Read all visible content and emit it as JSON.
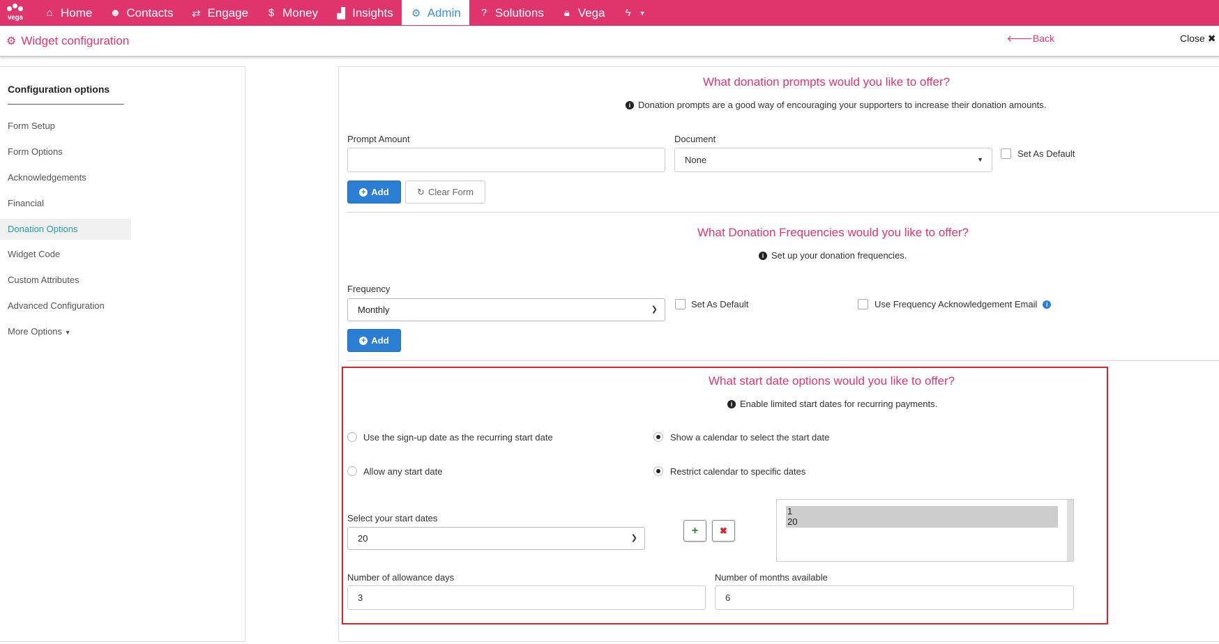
{
  "nav": {
    "logo_text": "vega",
    "items": [
      {
        "label": "Home",
        "icon": "home-icon"
      },
      {
        "label": "Contacts",
        "icon": "users-icon"
      },
      {
        "label": "Engage",
        "icon": "exchange-icon"
      },
      {
        "label": "Money",
        "icon": "dollar-icon"
      },
      {
        "label": "Insights",
        "icon": "chart-icon"
      },
      {
        "label": "Admin",
        "icon": "gears-icon"
      },
      {
        "label": "Solutions",
        "icon": "question-icon"
      },
      {
        "label": "Vega",
        "icon": "lock-icon"
      }
    ],
    "active": "Admin",
    "brand_color": "#e0356c"
  },
  "header": {
    "title": "Widget configuration",
    "back_label": "Back",
    "close_label": "Close"
  },
  "sidebar": {
    "heading": "Configuration options",
    "items": [
      {
        "label": "Form Setup"
      },
      {
        "label": "Form Options"
      },
      {
        "label": "Acknowledgements"
      },
      {
        "label": "Financial"
      },
      {
        "label": "Donation Options"
      },
      {
        "label": "Widget Code"
      },
      {
        "label": "Custom Attributes"
      },
      {
        "label": "Advanced Configuration"
      },
      {
        "label": "More Options"
      }
    ],
    "active": "Donation Options"
  },
  "prompts": {
    "title": "What donation prompts would you like to offer?",
    "info": "Donation prompts are a good way of encouraging your supporters to increase their donation amounts.",
    "amount_label": "Prompt Amount",
    "amount_value": "",
    "document_label": "Document",
    "document_value": "None",
    "default_label": "Set As Default",
    "add_label": "Add",
    "clear_label": "Clear Form"
  },
  "frequencies": {
    "title": "What Donation Frequencies would you like to offer?",
    "info": "Set up your donation frequencies.",
    "frequency_label": "Frequency",
    "frequency_value": "Monthly",
    "default_label": "Set As Default",
    "ack_email_label": "Use Frequency Acknowledgement Email",
    "add_label": "Add"
  },
  "start_dates": {
    "title": "What start date options would you like to offer?",
    "info": "Enable limited start dates for recurring payments.",
    "option_signup": "Use the sign-up date as the recurring start date",
    "option_calendar": "Show a calendar to select the start date",
    "option_any": "Allow any start date",
    "option_restrict": "Restrict calendar to specific dates",
    "select_label": "Select your start dates",
    "select_value": "20",
    "selected_dates": [
      "1",
      "20"
    ],
    "allowance_label": "Number of allowance days",
    "allowance_value": "3",
    "months_label": "Number of months available",
    "months_value": "6"
  }
}
